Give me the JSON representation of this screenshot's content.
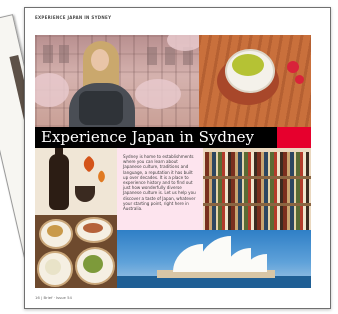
{
  "page": {
    "running_head": "EXPERIENCE JAPAN IN SYDNEY",
    "folio": "16 | Brief · Issue 54"
  },
  "feature": {
    "title": "Experience Japan in Sydney",
    "body": "Sydney is home to establishments where you can learn about Japanese culture, traditions and language, a reputation it has built up over decades. It is a place to experience history and to find out just how wonderfully diverse Japanese culture is. Let us help you discover a taste of Japan, whatever your starting point, right here in Australia."
  },
  "colors": {
    "title_band": "#000000",
    "accent_red": "#e6002d",
    "text_panel": "#fde4ee"
  },
  "images": [
    {
      "name": "woman-backpack-photo"
    },
    {
      "name": "green-tea-photo"
    },
    {
      "name": "sake-photo"
    },
    {
      "name": "bookshelf-photo"
    },
    {
      "name": "japanese-food-photo"
    },
    {
      "name": "sydney-opera-house-photo"
    }
  ]
}
